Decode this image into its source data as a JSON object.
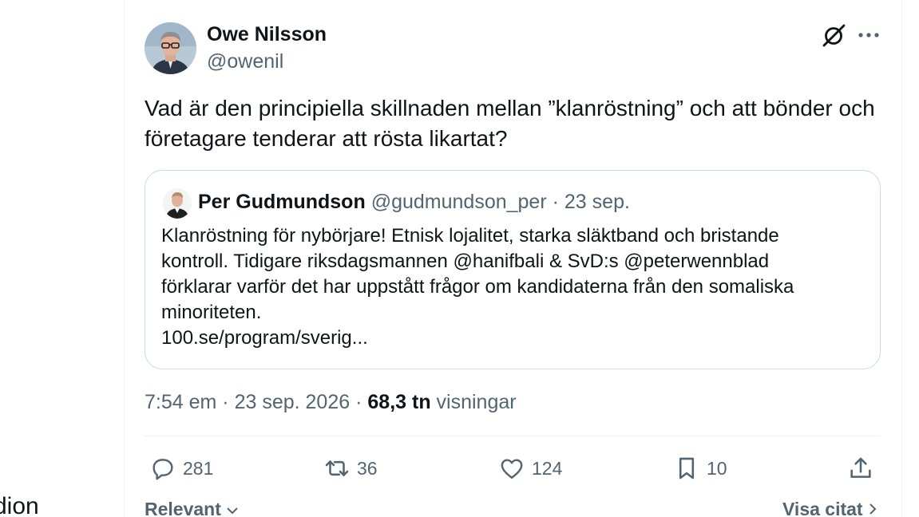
{
  "sidebar": {
    "partial_text": "dion"
  },
  "tweet": {
    "author_name": "Owe Nilsson",
    "author_handle": "@owenil",
    "text": "Vad är den principiella skillnaden mellan ”klanröstning” och att bönder och företagare tenderar att rösta likartat?",
    "time": "7:54 em",
    "date": "23 sep. 2026",
    "sep": "·",
    "views_count": "68,3 tn",
    "views_label": "visningar"
  },
  "quote": {
    "author_name": "Per Gudmundson",
    "author_handle": "@gudmundson_per",
    "date": "23 sep.",
    "sep": "·",
    "body_lines": [
      "Klanröstning för nybörjare! Etnisk lojalitet, starka släktband och bristande",
      "kontroll. Tidigare riksdagsmannen @hanifbali & SvD:s @peterwennblad",
      "förklarar varför det har uppstått frågor om kandidaterna från den somaliska",
      "minoriteten.",
      "100.se/program/sverig..."
    ]
  },
  "actions": {
    "replies": "281",
    "reposts": "36",
    "likes": "124",
    "bookmarks": "10"
  },
  "footer": {
    "relevant_label": "Relevant",
    "quotes_label": "Visa citat"
  },
  "icons": {
    "grok": "grok-icon",
    "more": "more-icon",
    "reply": "reply-icon",
    "repost": "repost-icon",
    "like": "heart-icon",
    "bookmark": "bookmark-icon",
    "share": "share-icon"
  },
  "colors": {
    "text": "#0f1419",
    "secondary": "#536471",
    "border": "#cfd9de"
  }
}
